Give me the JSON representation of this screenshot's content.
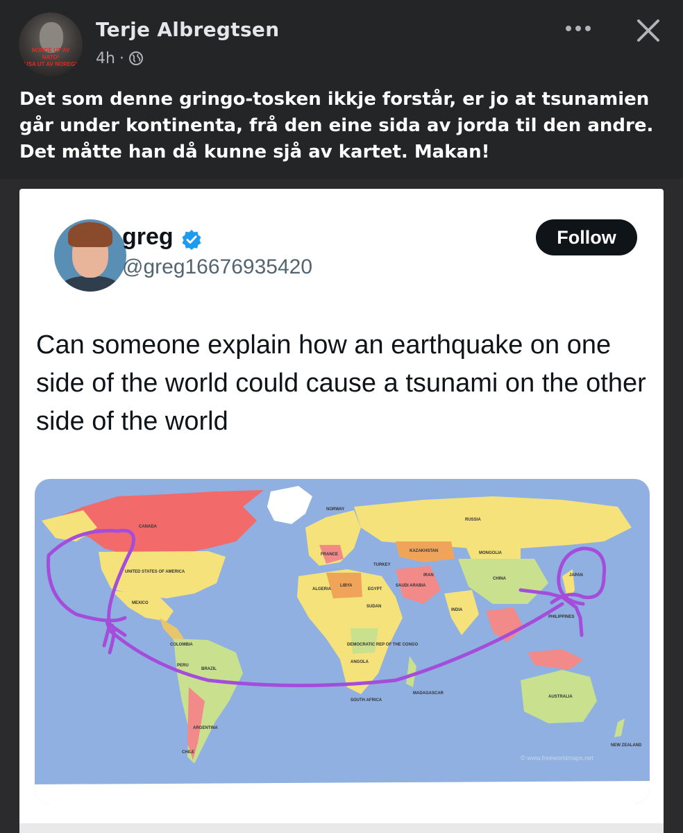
{
  "post": {
    "author": "Terje Albregtsen",
    "avatar_banner_line1": "NORGE UT AV NATO!",
    "avatar_banner_line2": "USA UT AV NOREG!",
    "time": "4h",
    "separator": "·",
    "privacy_icon": "globe-icon",
    "text": "Det som denne gringo-tosken ikkje forstår, er jo at tsunamien går under kontinenta, frå den eine sida av jorda til den andre. Det måtte han då kunne sjå av kartet. Makan!"
  },
  "tweet": {
    "name": "greg",
    "handle": "@greg16676935420",
    "follow_label": "Follow",
    "text": "Can someone explain how an earthquake on one side of the world could cause a tsunami on the other side of the world",
    "verified_icon": "verified-badge-icon"
  },
  "map": {
    "labels": {
      "canada": "CANADA",
      "usa": "UNITED STATES OF AMERICA",
      "mexico": "MEXICO",
      "brazil": "BRAZIL",
      "russia": "RUSSIA",
      "china": "CHINA",
      "australia": "AUSTRALIA",
      "japan": "JAPAN",
      "mongolia": "MONGOLIA",
      "kazakhstan": "KAZAKHSTAN",
      "india": "INDIA",
      "algeria": "ALGERIA",
      "libya": "LIBYA",
      "egypt": "EGYPT",
      "sudan": "SUDAN",
      "congo": "DEMOCRATIC REP OF THE CONGO",
      "angola": "ANGOLA",
      "south_africa": "SOUTH AFRICA",
      "argentina": "ARGENTINA",
      "peru": "PERU",
      "colombia": "COLOMBIA",
      "saudi": "SAUDI ARABIA",
      "iran": "IRAN",
      "turkey": "TURKEY",
      "france": "FRANCE",
      "norway": "NORWAY",
      "philippines": "PHILIPPINES",
      "new_zealand": "NEW ZEALAND",
      "madagascar": "MADAGASCAR",
      "chile": "CHILE",
      "watermark": "© www.freeworldmaps.net"
    },
    "colors": {
      "ocean": "#8fb0e0",
      "annotation": "#a44ddb"
    }
  }
}
